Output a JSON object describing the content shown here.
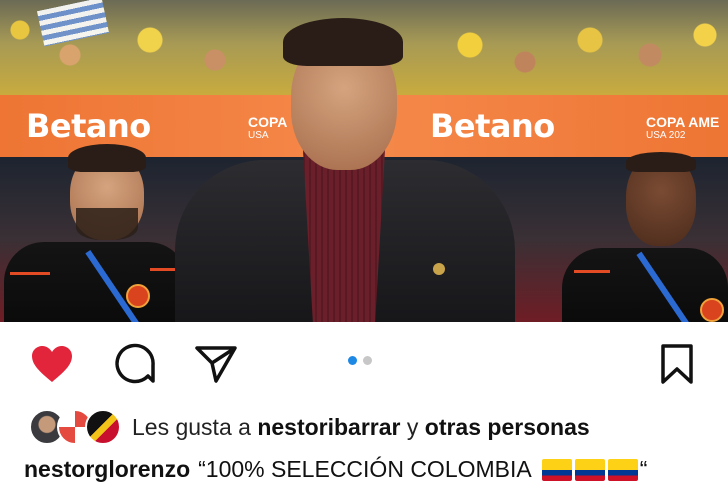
{
  "post": {
    "image": {
      "banner_brand": "Betano",
      "banner_event_1": "COPA",
      "banner_event_1_sub": "USA",
      "banner_event_2": "COPA AME",
      "banner_event_2_sub": "USA 202"
    },
    "carousel": {
      "total": 2,
      "active_index": 0
    },
    "liked": true,
    "accent_color": "#1e88e5",
    "like_color": "#e3253b",
    "actions": {
      "like_icon": "heart-icon",
      "comment_icon": "comment-icon",
      "share_icon": "send-icon",
      "save_icon": "bookmark-icon"
    },
    "likes": {
      "prefix": "Les gusta a",
      "user": "nestoribarrar",
      "connector": "y",
      "others": "otras personas"
    },
    "caption": {
      "username": "nestorglorenzo",
      "text_open": "“100% SELECCIÓN COLOMBIA",
      "flags_count": 3,
      "text_close": "“"
    }
  }
}
